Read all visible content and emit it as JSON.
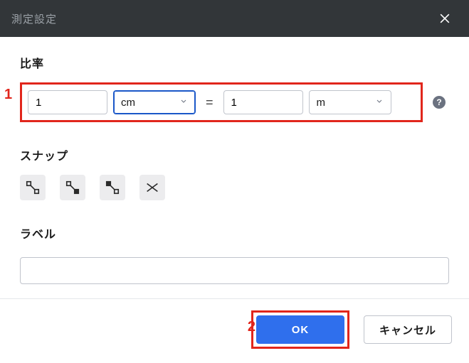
{
  "dialog": {
    "title": "測定設定"
  },
  "ratio": {
    "label": "比率",
    "left_value": "1",
    "left_unit": "cm",
    "equals": "=",
    "right_value": "1",
    "right_unit": "m"
  },
  "snap": {
    "label": "スナップ"
  },
  "label_field": {
    "label": "ラベル",
    "value": ""
  },
  "footer": {
    "ok": "OK",
    "cancel": "キャンセル"
  },
  "annotations": {
    "one": "1",
    "two": "2"
  },
  "help_tooltip": "?"
}
